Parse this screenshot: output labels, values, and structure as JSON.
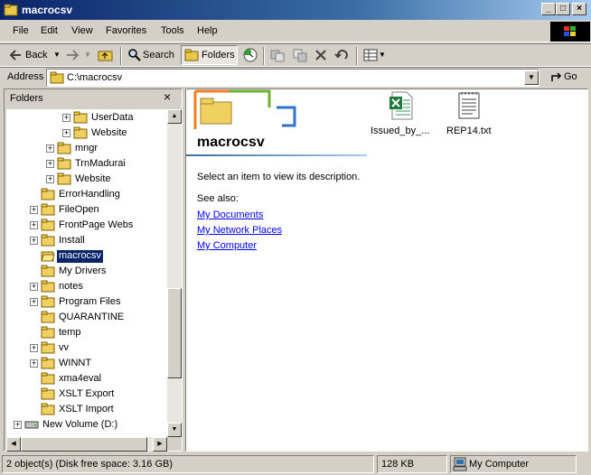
{
  "window": {
    "title": "macrocsv"
  },
  "menu": [
    "File",
    "Edit",
    "View",
    "Favorites",
    "Tools",
    "Help"
  ],
  "toolbar": {
    "back_label": "Back",
    "search_label": "Search",
    "folders_label": "Folders"
  },
  "address": {
    "label": "Address",
    "value": "C:\\macrocsv",
    "go_label": "Go"
  },
  "folders_pane": {
    "title": "Folders",
    "close_label": "×",
    "tree": [
      {
        "label": "UserData",
        "expander": "+"
      },
      {
        "label": "Website",
        "expander": "+"
      },
      {
        "label": "mngr",
        "expander": "+"
      },
      {
        "label": "TrnMadurai",
        "expander": "+"
      },
      {
        "label": "Website",
        "expander": "+"
      },
      {
        "label": "ErrorHandling",
        "expander": ""
      },
      {
        "label": "FileOpen",
        "expander": "+"
      },
      {
        "label": "FrontPage Webs",
        "expander": "+"
      },
      {
        "label": "Install",
        "expander": "+"
      },
      {
        "label": "macrocsv",
        "expander": "",
        "selected": true
      },
      {
        "label": "My Drivers",
        "expander": ""
      },
      {
        "label": "notes",
        "expander": "+"
      },
      {
        "label": "Program Files",
        "expander": "+"
      },
      {
        "label": "QUARANTINE",
        "expander": ""
      },
      {
        "label": "temp",
        "expander": ""
      },
      {
        "label": "vv",
        "expander": "+"
      },
      {
        "label": "WINNT",
        "expander": "+"
      },
      {
        "label": "xma4eval",
        "expander": ""
      },
      {
        "label": "XSLT Export",
        "expander": ""
      },
      {
        "label": "XSLT Import",
        "expander": ""
      },
      {
        "label": "New Volume (D:)",
        "expander": "+"
      }
    ]
  },
  "content": {
    "folder_title": "macrocsv",
    "description": "Select an item to view its description.",
    "see_also": "See also:",
    "links": [
      "My Documents",
      "My Network Places",
      "My Computer"
    ],
    "files": [
      {
        "name": "Issued_by_...",
        "icon": "excel-file-icon"
      },
      {
        "name": "REP14.txt",
        "icon": "text-file-icon"
      }
    ]
  },
  "status": {
    "objects": "2 object(s) (Disk free space: 3.16 GB)",
    "size": "128 KB",
    "zone": "My Computer"
  }
}
